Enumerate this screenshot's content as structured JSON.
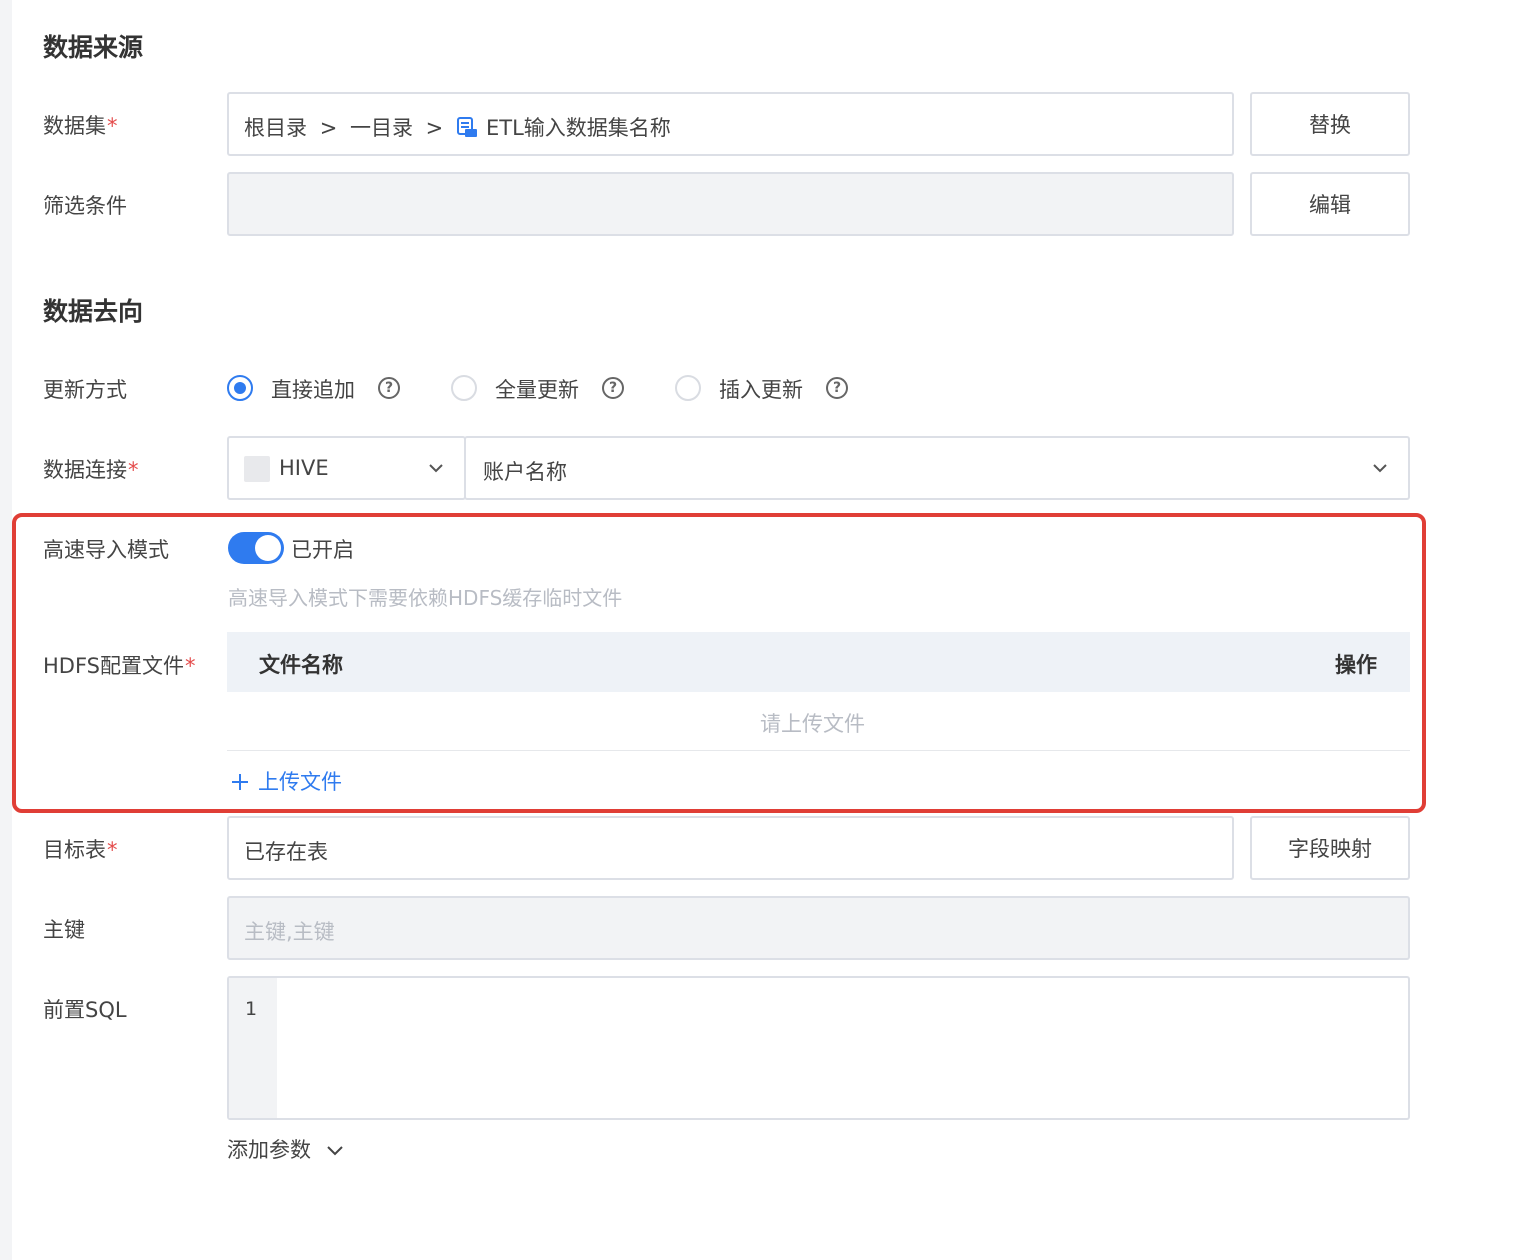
{
  "source": {
    "title": "数据来源",
    "dataset": {
      "label": "数据集",
      "path_root": "根目录",
      "path_sep": ">",
      "path_folder": "一目录",
      "dataset_icon": "etl-dataset-icon",
      "dataset_name": "ETL输入数据集名称",
      "button": "替换"
    },
    "filter": {
      "label": "筛选条件",
      "value": "",
      "button": "编辑"
    }
  },
  "target": {
    "title": "数据去向",
    "update_mode": {
      "label": "更新方式",
      "options": [
        {
          "label": "直接追加",
          "checked": true
        },
        {
          "label": "全量更新",
          "checked": false
        },
        {
          "label": "插入更新",
          "checked": false
        }
      ]
    },
    "connection": {
      "label": "数据连接",
      "db_type": "HIVE",
      "account": "账户名称"
    },
    "fast_import": {
      "label": "高速导入模式",
      "enabled": true,
      "status": "已开启",
      "hint": "高速导入模式下需要依赖HDFS缓存临时文件"
    },
    "hdfs": {
      "label": "HDFS配置文件",
      "col_name": "文件名称",
      "col_action": "操作",
      "empty": "请上传文件",
      "upload": "上传文件"
    },
    "target_table": {
      "label": "目标表",
      "value": "已存在表",
      "button": "字段映射"
    },
    "primary_key": {
      "label": "主键",
      "placeholder": "主键,主键"
    },
    "pre_sql": {
      "label": "前置SQL",
      "line_number": "1"
    },
    "add_params": "添加参数"
  },
  "colors": {
    "accent": "#2f7bef",
    "highlight": "#e03e36",
    "required": "#e44c4c"
  }
}
